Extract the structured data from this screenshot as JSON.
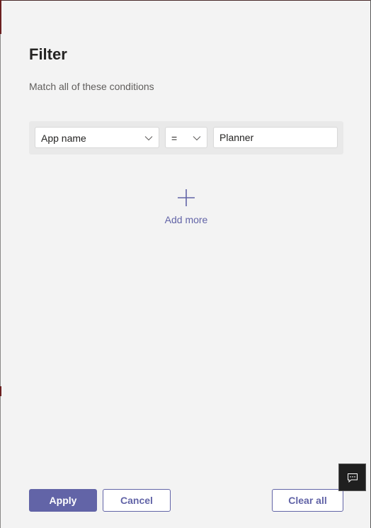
{
  "panel": {
    "title": "Filter",
    "subtitle": "Match all of these conditions"
  },
  "condition": {
    "field": "App name",
    "operator": "=",
    "value": "Planner"
  },
  "add_more": {
    "label": "Add more",
    "icon": "plus-icon"
  },
  "footer": {
    "apply_label": "Apply",
    "cancel_label": "Cancel",
    "clear_label": "Clear all"
  },
  "feedback": {
    "icon": "feedback-chat-icon"
  },
  "colors": {
    "accent": "#6264a7",
    "background": "#f3f3f3",
    "row_background": "#e9e9e9"
  }
}
